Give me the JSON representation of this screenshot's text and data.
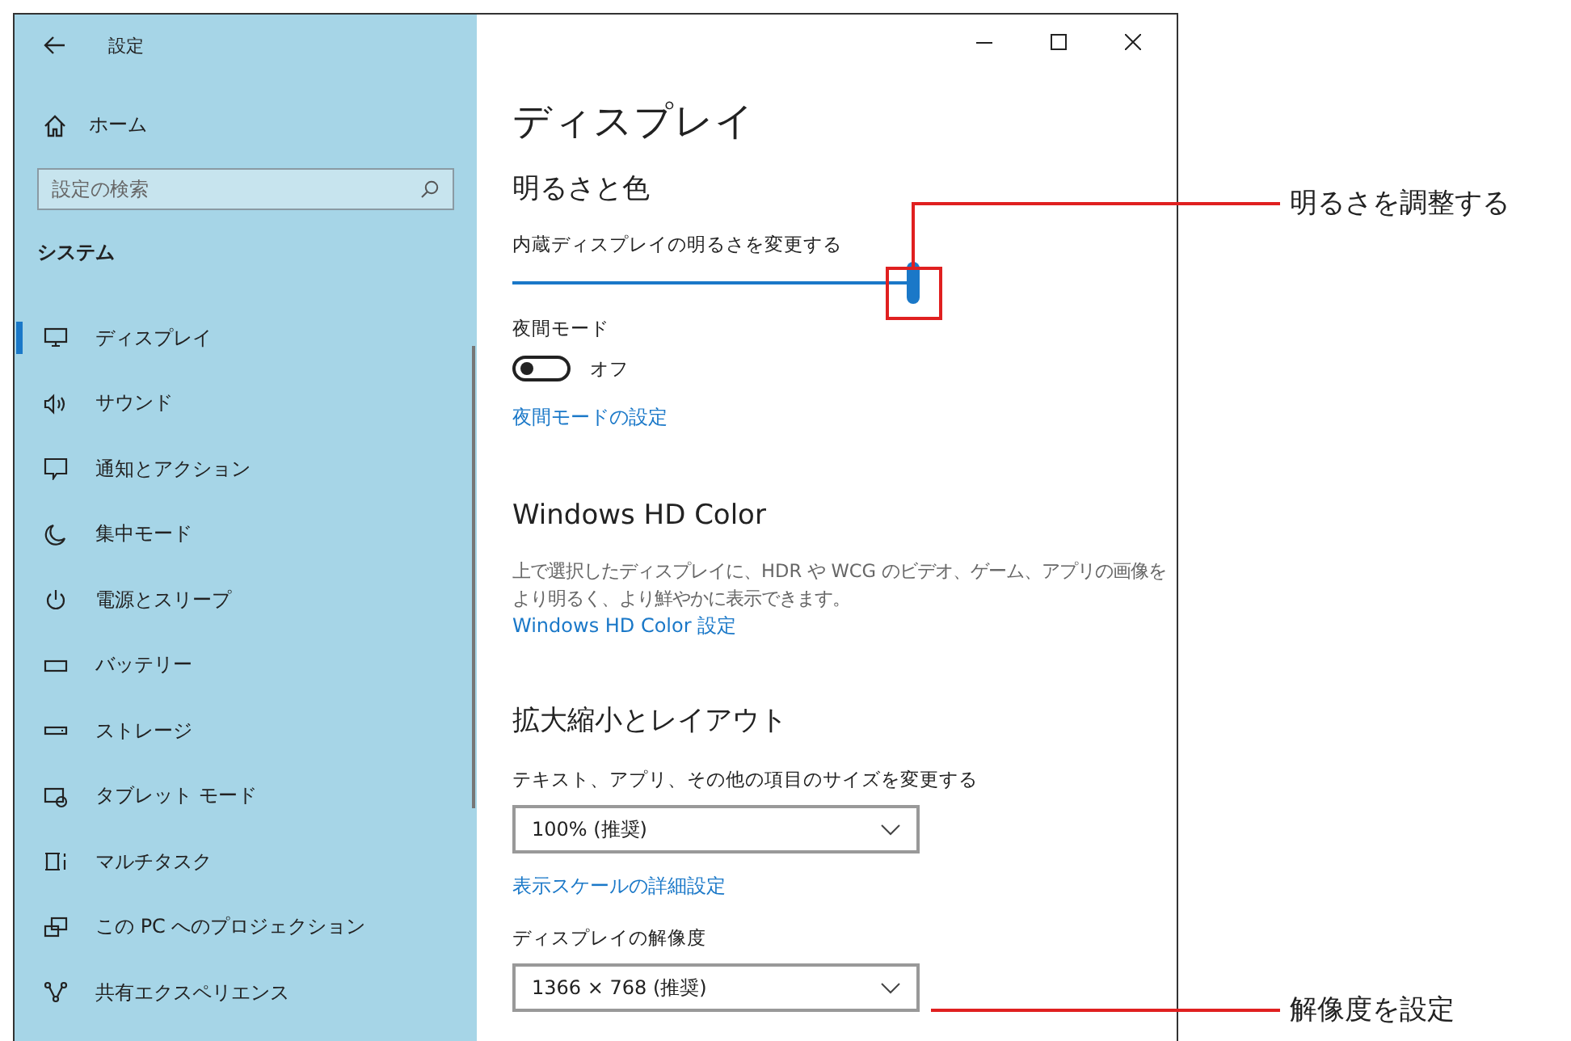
{
  "window": {
    "title": "設定"
  },
  "sidebar": {
    "home": "ホーム",
    "search": {
      "placeholder": "設定の検索"
    },
    "section": "システム",
    "items": [
      {
        "label": "ディスプレイ",
        "selected": true
      },
      {
        "label": "サウンド",
        "selected": false
      },
      {
        "label": "通知とアクション",
        "selected": false
      },
      {
        "label": "集中モード",
        "selected": false
      },
      {
        "label": "電源とスリープ",
        "selected": false
      },
      {
        "label": "バッテリー",
        "selected": false
      },
      {
        "label": "ストレージ",
        "selected": false
      },
      {
        "label": "タブレット モード",
        "selected": false
      },
      {
        "label": "マルチタスク",
        "selected": false
      },
      {
        "label": "この PC へのプロジェクション",
        "selected": false
      },
      {
        "label": "共有エクスペリエンス",
        "selected": false
      }
    ]
  },
  "page": {
    "title": "ディスプレイ",
    "brightness": {
      "heading": "明るさと色",
      "label": "内蔵ディスプレイの明るさを変更する",
      "level": 1.0
    },
    "night_mode": {
      "label": "夜間モード",
      "on": false,
      "state_text": "オフ",
      "link": "夜間モードの設定"
    },
    "hd_color": {
      "heading": "Windows HD Color",
      "description": "上で選択したディスプレイに、HDR や WCG のビデオ、ゲーム、アプリの画像をより明るく、より鮮やかに表示できます。",
      "link": "Windows HD Color 設定"
    },
    "scale": {
      "heading": "拡大縮小とレイアウト",
      "size_label": "テキスト、アプリ、その他の項目のサイズを変更する",
      "size_value": "100% (推奨)",
      "advanced_link": "表示スケールの詳細設定",
      "resolution_label": "ディスプレイの解像度",
      "resolution_value": "1366 × 768 (推奨)"
    }
  },
  "annotations": [
    {
      "text": "明るさを調整する"
    },
    {
      "text": "解像度を設定"
    }
  ]
}
